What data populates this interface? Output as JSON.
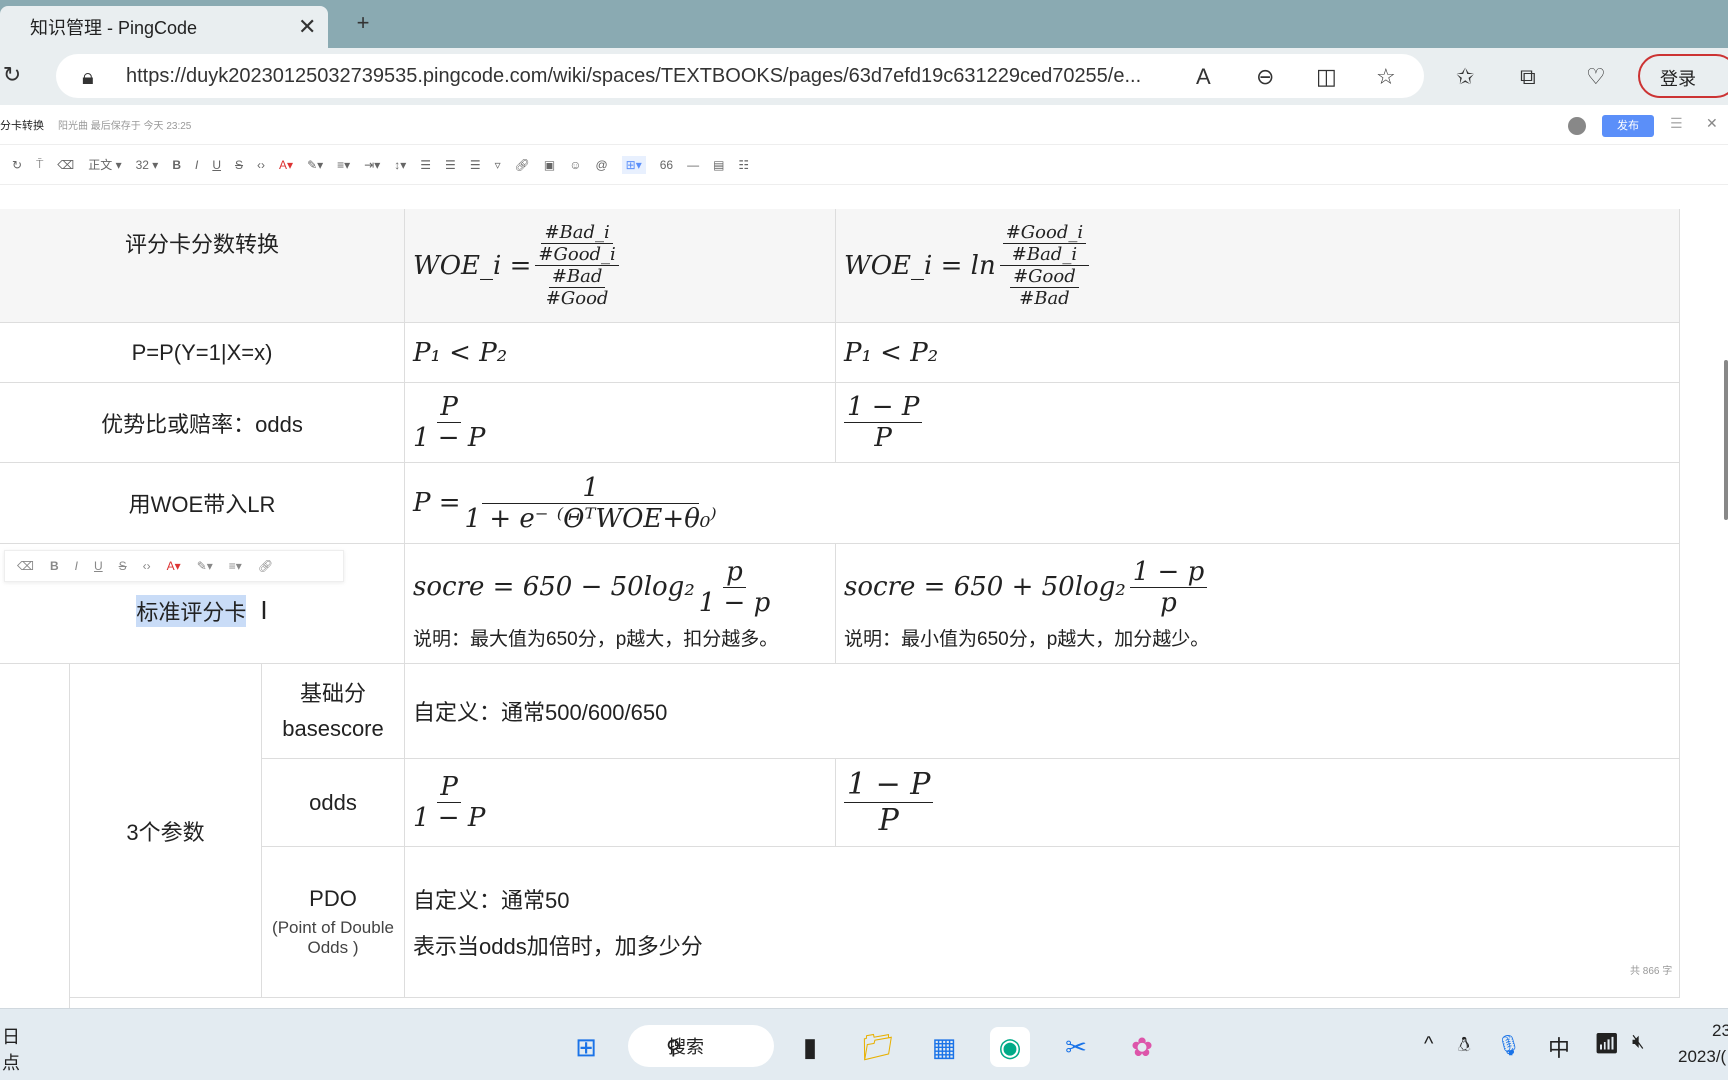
{
  "browser": {
    "tab_title": "知识管理 - PingCode",
    "url": "https://duyk20230125032739535.pingcode.com/wiki/spaces/TEXTBOOKS/pages/63d7efd19c631229ced70255/e...",
    "login": "登录"
  },
  "doc": {
    "title": "分卡转换",
    "save_status": "阳光曲 最后保存于 今天 23:25",
    "publish": "发布",
    "word_count": "共 866 字"
  },
  "toolbar": {
    "style": "正文",
    "size": "32"
  },
  "table": {
    "r1": {
      "label": "评分卡分数转换",
      "woe1_lhs": "WOE_i =",
      "woe1_num_num": "#Bad_i",
      "woe1_num_den": "#Good_i",
      "woe1_den_num": "#Bad",
      "woe1_den_den": "#Good",
      "woe2_lhs": "WOE_i = ln",
      "woe2_num_num": "#Good_i",
      "woe2_num_den": "#Bad_i",
      "woe2_den_num": "#Good",
      "woe2_den_den": "#Bad"
    },
    "r2": {
      "label": "P=P(Y=1|X=x)",
      "a": "P₁ < P₂",
      "b": "P₁ < P₂"
    },
    "r3": {
      "label": "优势比或赔率：odds",
      "a_num": "P",
      "a_den": "1 − P",
      "b_num": "1 − P",
      "b_den": "P"
    },
    "r4": {
      "label": "用WOE带入LR",
      "lhs": "P =",
      "num": "1",
      "den": "1 + e⁻ ⁽ΘᵀWOE+θ₀⁾"
    },
    "r5": {
      "label": "标准评分卡",
      "a_lhs": "socre = 650 − 50log₂",
      "a_num": "p",
      "a_den": "1 − p",
      "a_note": "说明：最大值为650分，p越大，扣分越多。",
      "b_lhs": "socre = 650 + 50log₂",
      "b_num": "1 − p",
      "b_den": "p",
      "b_note": "说明：最小值为650分，p越大，加分越少。"
    },
    "group": {
      "label": "3个参数",
      "base_label1": "基础分",
      "base_label2": "basescore",
      "base_val": "自定义：通常500/600/650",
      "odds_label": "odds",
      "odds_a_num": "P",
      "odds_a_den": "1 − P",
      "odds_b_num": "1 − P",
      "odds_b_den": "P",
      "pdo_label1": "PDO",
      "pdo_label2": "(Point of Double Odds )",
      "pdo_val1": "自定义：通常50",
      "pdo_val2": "表示当odds加倍时，加多少分"
    }
  },
  "taskbar": {
    "search": "搜索",
    "ime": "中",
    "left1": "日",
    "left2": "点",
    "clock_time": "23",
    "clock_date": "2023/("
  }
}
